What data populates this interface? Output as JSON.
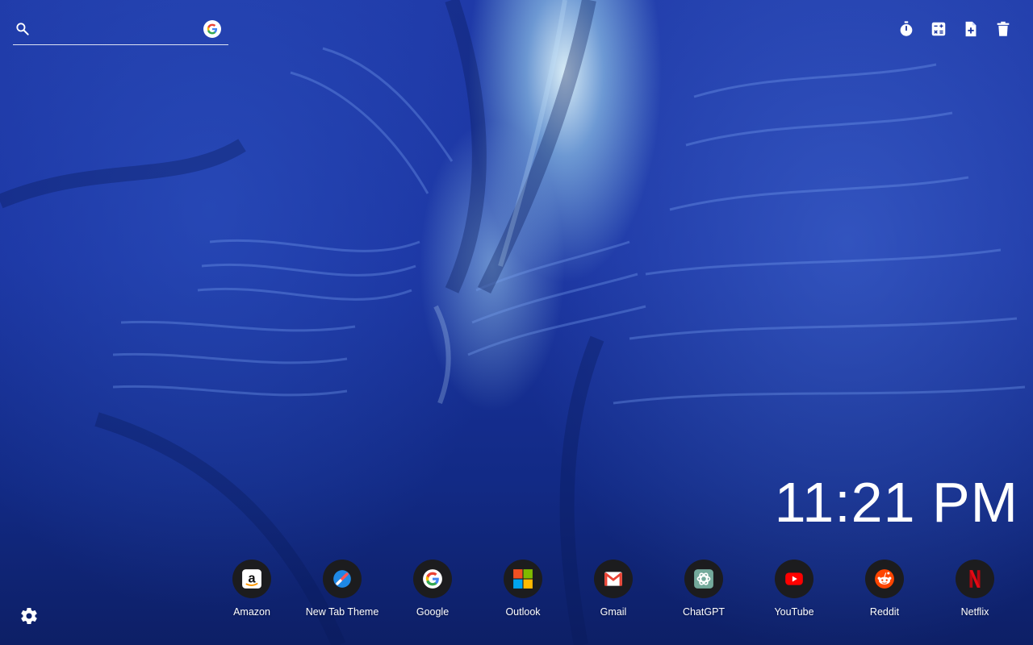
{
  "search": {
    "value": "",
    "placeholder": "",
    "engine_icon": "google-g-icon"
  },
  "toolbar": {
    "items": [
      {
        "name": "timer",
        "icon": "stopwatch-icon"
      },
      {
        "name": "calculator",
        "icon": "calculator-icon"
      },
      {
        "name": "new-note",
        "icon": "note-add-icon"
      },
      {
        "name": "delete",
        "icon": "trash-icon"
      }
    ]
  },
  "clock": {
    "time": "11:21 PM"
  },
  "shortcuts": [
    {
      "label": "Amazon",
      "icon": "amazon-icon"
    },
    {
      "label": "New Tab Theme",
      "icon": "new-tab-theme-icon"
    },
    {
      "label": "Google",
      "icon": "google-icon"
    },
    {
      "label": "Outlook",
      "icon": "microsoft-icon"
    },
    {
      "label": "Gmail",
      "icon": "gmail-icon"
    },
    {
      "label": "ChatGPT",
      "icon": "chatgpt-icon"
    },
    {
      "label": "YouTube",
      "icon": "youtube-icon"
    },
    {
      "label": "Reddit",
      "icon": "reddit-icon"
    },
    {
      "label": "Netflix",
      "icon": "netflix-icon"
    }
  ],
  "settings": {
    "icon": "gear-icon"
  },
  "colors": {
    "background_accent": "#1a33a0",
    "text": "#ffffff",
    "shortcut_circle": "#1c1c1e"
  }
}
